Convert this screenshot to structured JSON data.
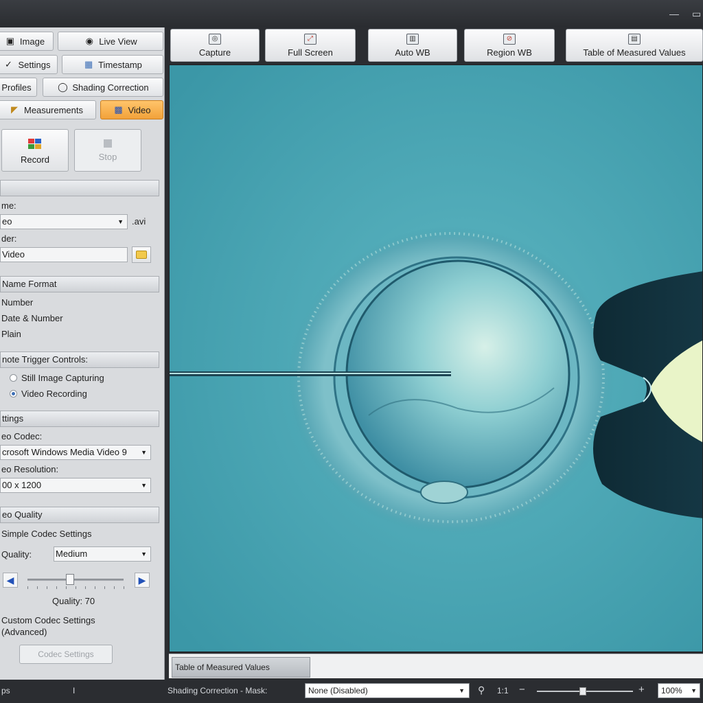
{
  "window": {
    "maximize_glyph": "▭",
    "minimize_glyph": "—"
  },
  "left_panel": {
    "tabs": [
      {
        "label": "Image",
        "icon": "image-icon"
      },
      {
        "label": "Live View",
        "icon": "camera-icon"
      },
      {
        "label": "Settings",
        "icon": "settings-icon"
      },
      {
        "label": "Timestamp",
        "icon": "calendar-icon"
      },
      {
        "label": "Profiles",
        "icon": "profiles-icon"
      },
      {
        "label": "Shading Correction",
        "icon": "circle-icon"
      },
      {
        "label": "Measurements",
        "icon": "ruler-icon"
      },
      {
        "label": "Video",
        "icon": "video-icon",
        "active": true
      }
    ],
    "record_label": "Record",
    "stop_label": "Stop",
    "file": {
      "name_label": "me:",
      "name_value": "eo",
      "extension": ".avi",
      "folder_label": "der:",
      "folder_value": "Video"
    },
    "name_format": {
      "header": "Name Format",
      "options": [
        "Number",
        "Date & Number",
        "Plain"
      ]
    },
    "remote_trigger": {
      "header": "note Trigger Controls:",
      "options": [
        "Still Image Capturing",
        "Video Recording"
      ],
      "selected": "Video Recording"
    },
    "settings": {
      "header": "ttings",
      "codec_label": "eo Codec:",
      "codec_value": "crosoft Windows Media Video 9",
      "resolution_label": "eo Resolution:",
      "resolution_value": "00 x 1200"
    },
    "quality": {
      "header": "eo Quality",
      "simple_label": "Simple Codec Settings",
      "quality_label": "Quality:",
      "quality_value": "Medium",
      "slider_text": "Quality: 70",
      "slider_value": 70,
      "custom_label_1": "Custom Codec Settings",
      "custom_label_2": "(Advanced)",
      "codec_settings_button": "Codec Settings"
    }
  },
  "toolbar": [
    {
      "label": "Capture",
      "icon": "camera-icon"
    },
    {
      "label": "Full Screen",
      "icon": "fullscreen-icon"
    },
    {
      "label": "Auto WB",
      "icon": "auto-wb-icon"
    },
    {
      "label": "Region WB",
      "icon": "region-wb-icon"
    },
    {
      "label": "Table of Measured Values",
      "icon": "table-icon"
    }
  ],
  "bottom_tab": "Table of Measured Values",
  "statusbar": {
    "left_text": "ps",
    "separator": "I",
    "mask_label": "Shading Correction - Mask:",
    "mask_value": "None (Disabled)",
    "ratio": "1:1",
    "zoom_value": "100%"
  },
  "colors": {
    "active_tab": "#f2a23a",
    "viewer_bg": "#4aa3b1"
  }
}
